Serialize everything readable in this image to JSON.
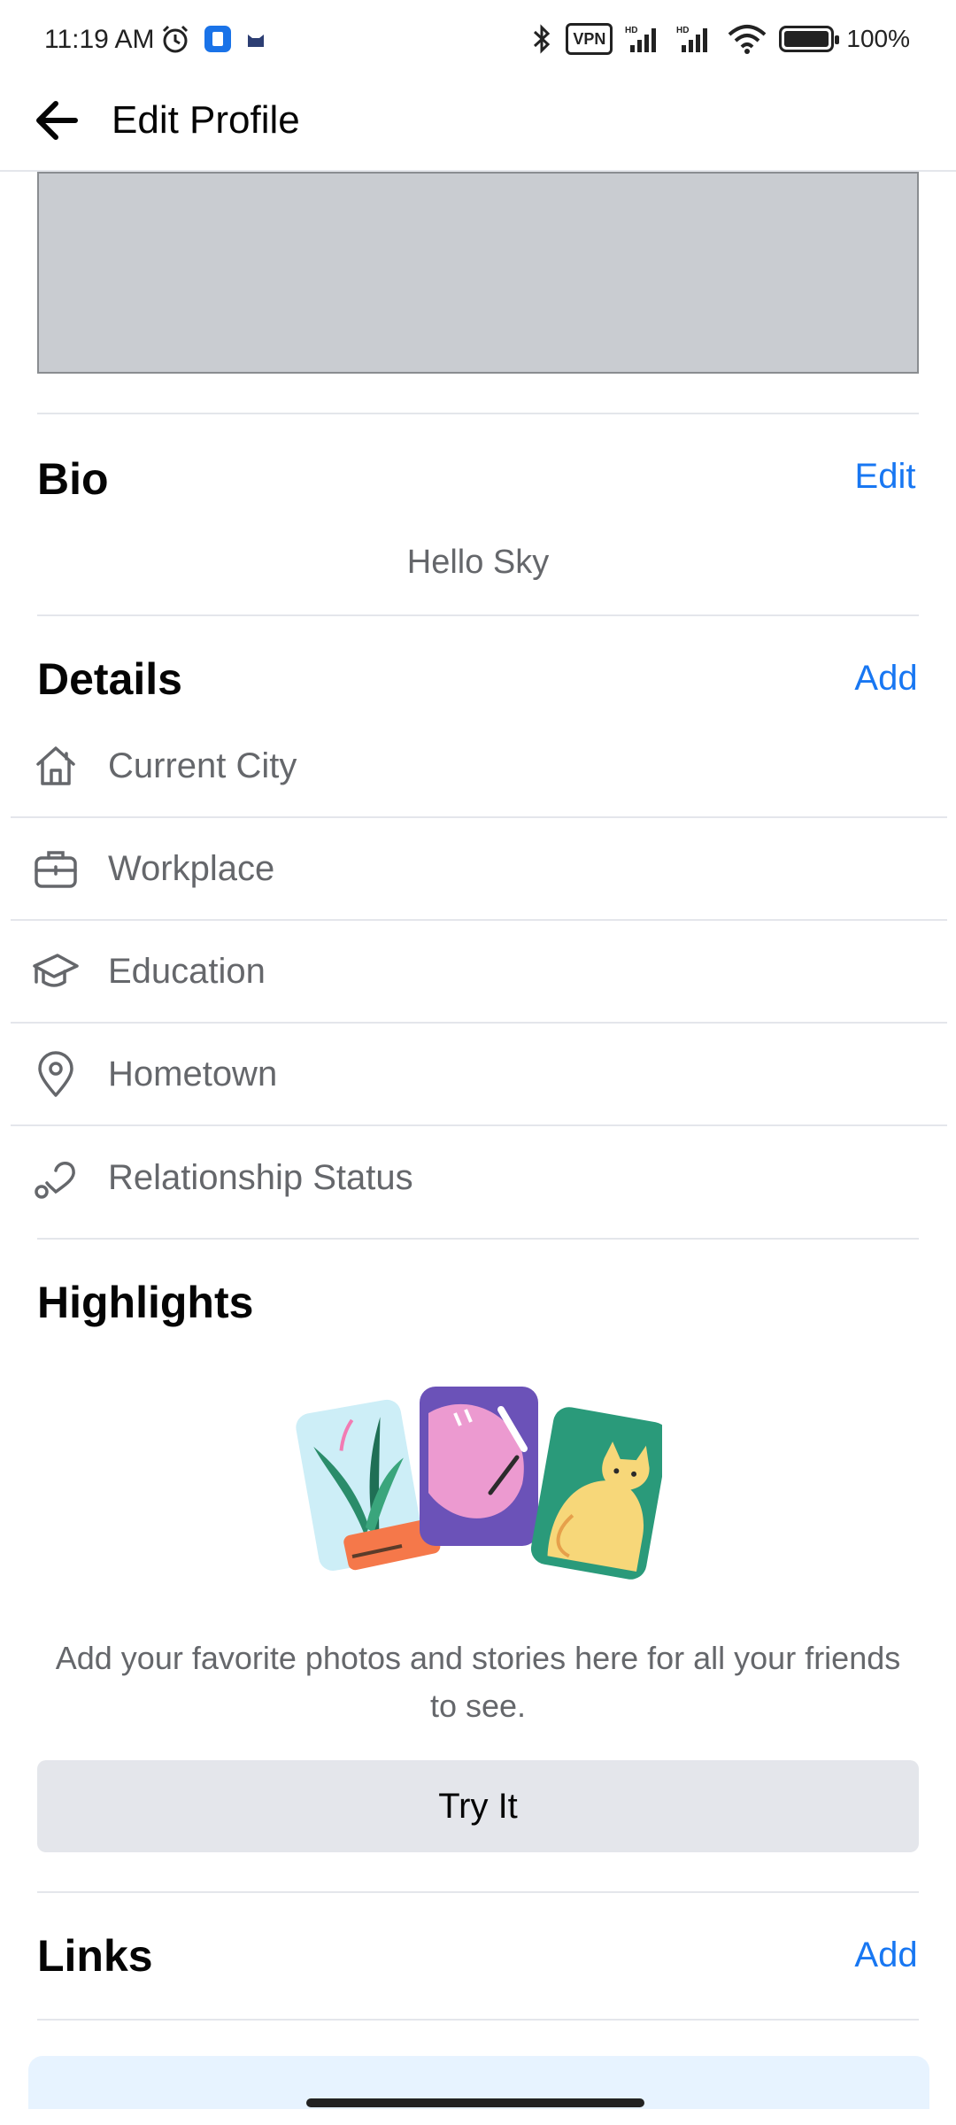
{
  "status_bar": {
    "time": "11:19 AM",
    "vpn_label": "VPN",
    "battery": "100%",
    "icons": [
      "alarm-icon",
      "app-notification-icon",
      "cat-icon",
      "bluetooth-icon",
      "vpn-icon",
      "hd-signal-icon",
      "hd-signal-icon",
      "wifi-icon",
      "battery-icon"
    ]
  },
  "app_bar": {
    "back_icon": "arrow-left-icon",
    "title": "Edit Profile"
  },
  "bio": {
    "title": "Bio",
    "action": "Edit",
    "text": "Hello Sky"
  },
  "details": {
    "title": "Details",
    "action": "Add",
    "items": [
      {
        "icon": "house-icon",
        "label": "Current City"
      },
      {
        "icon": "briefcase-icon",
        "label": "Workplace"
      },
      {
        "icon": "graduation-cap-icon",
        "label": "Education"
      },
      {
        "icon": "location-pin-icon",
        "label": "Hometown"
      },
      {
        "icon": "heart-icon",
        "label": "Relationship Status"
      }
    ]
  },
  "highlights": {
    "title": "Highlights",
    "illustration": "photo-cards-illustration",
    "description": "Add your favorite photos and stories here for all your friends to see.",
    "button": "Try It"
  },
  "links": {
    "title": "Links",
    "action": "Add"
  },
  "colors": {
    "accent": "#1877f2",
    "secondary_text": "#65676b",
    "cover_gray": "#c9ccd1",
    "button_gray": "#e4e6eb"
  }
}
